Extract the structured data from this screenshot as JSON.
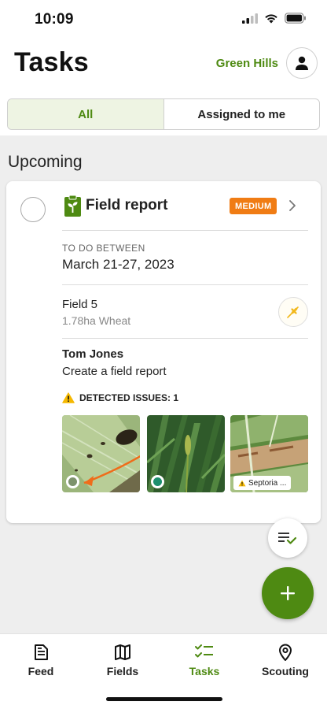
{
  "status_bar": {
    "time": "10:09"
  },
  "header": {
    "title": "Tasks",
    "farm_name": "Green Hills"
  },
  "filter_tabs": [
    {
      "label": "All",
      "active": true
    },
    {
      "label": "Assigned to me",
      "active": false
    }
  ],
  "section_title": "Upcoming",
  "task": {
    "type": "Field report",
    "priority": "MEDIUM",
    "date_label": "TO DO BETWEEN",
    "date_range": "March 21-27, 2023",
    "field_name": "Field 5",
    "field_details": "1.78ha Wheat",
    "assignee": "Tom Jones",
    "description": "Create a field report",
    "issues_label": "DETECTED ISSUES: 1",
    "photos": [
      {
        "status": "pending"
      },
      {
        "status": "done"
      },
      {
        "tag": "Septoria ..."
      }
    ]
  },
  "colors": {
    "brand": "#4e8a12",
    "priority": "#f07c14",
    "background": "#eeeeee"
  },
  "bottom_nav": [
    {
      "label": "Feed",
      "icon": "feed-icon",
      "active": false
    },
    {
      "label": "Fields",
      "icon": "map-icon",
      "active": false
    },
    {
      "label": "Tasks",
      "icon": "tasks-icon",
      "active": true
    },
    {
      "label": "Scouting",
      "icon": "location-pin-icon",
      "active": false
    }
  ]
}
